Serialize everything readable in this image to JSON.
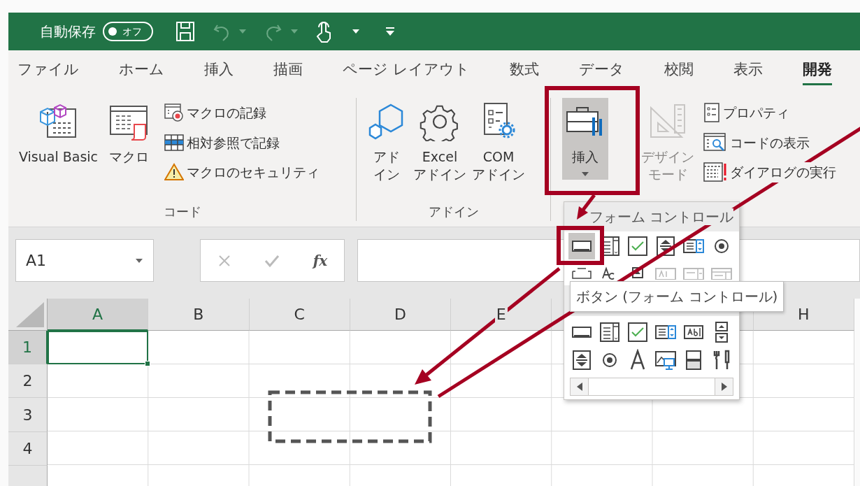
{
  "title_bar": {
    "autosave_label": "自動保存",
    "autosave_toggle": {
      "label": "オフ",
      "on": false
    },
    "tools": [
      {
        "disabled": false
      },
      {
        "disabled": true
      },
      {
        "disabled": true
      },
      {
        "disabled": false
      }
    ]
  },
  "ribbon_tabs": [
    {
      "label": "ファイル",
      "selected": false
    },
    {
      "label": "ホーム",
      "selected": false
    },
    {
      "label": "挿入",
      "selected": false
    },
    {
      "label": "描画",
      "selected": false
    },
    {
      "label": "ページ レイアウト",
      "selected": false
    },
    {
      "label": "数式",
      "selected": false
    },
    {
      "label": "データ",
      "selected": false
    },
    {
      "label": "校閲",
      "selected": false
    },
    {
      "label": "表示",
      "selected": false
    },
    {
      "label": "開発",
      "selected": true
    }
  ],
  "ribbon_groups": [
    {
      "label": "コード",
      "large_buttons": [
        {
          "lines": [
            "Visual Basic"
          ],
          "pressed": false,
          "disabled": false
        },
        {
          "lines": [
            "マクロ"
          ],
          "pressed": false,
          "disabled": false
        }
      ],
      "small_buttons": [
        {
          "label": "マクロの記録"
        },
        {
          "label": "相対参照で記録"
        },
        {
          "label": "マクロのセキュリティ"
        }
      ]
    },
    {
      "label": "アドイン",
      "large_buttons": [
        {
          "lines": [
            "アド",
            "イン"
          ],
          "pressed": false,
          "disabled": false
        },
        {
          "lines": [
            "Excel",
            "アドイン"
          ],
          "pressed": false,
          "disabled": false
        },
        {
          "lines": [
            "COM",
            "アドイン"
          ],
          "pressed": false,
          "disabled": false
        }
      ]
    },
    {
      "large_buttons": [
        {
          "lines": [
            "挿入"
          ],
          "pressed": true,
          "disabled": false,
          "dropdown": true
        },
        {
          "lines": [
            "デザイン",
            "モード"
          ],
          "pressed": false,
          "disabled": true
        }
      ],
      "small_buttons": [
        {
          "label": "プロパティ"
        },
        {
          "label": "コードの表示"
        },
        {
          "label": "ダイアログの実行"
        }
      ]
    }
  ],
  "formula_bar": {
    "name_box": "A1",
    "function_label": "fx"
  },
  "sheet": {
    "columns": [
      {
        "label": "A",
        "selected": true
      },
      {
        "label": "B",
        "selected": false
      },
      {
        "label": "C",
        "selected": false
      },
      {
        "label": "D",
        "selected": false
      },
      {
        "label": "E",
        "selected": false
      },
      {
        "selected": false
      },
      {
        "selected": false
      },
      {
        "label": "H",
        "selected": false
      }
    ],
    "rows": [
      {
        "label": "1",
        "selected": true
      },
      {
        "label": "2",
        "selected": false
      },
      {
        "label": "3",
        "selected": false
      },
      {
        "label": "4",
        "selected": false
      },
      {
        "selected": false
      }
    ]
  },
  "insert_menu": {
    "header": "フォーム コントロール",
    "form_controls": [
      {
        "selected": true
      },
      {
        "selected": false
      },
      {
        "selected": false
      },
      {
        "selected": false
      },
      {
        "selected": false
      },
      {
        "selected": false
      },
      {
        "selected": false
      },
      {
        "selected": false
      },
      {
        "selected": false
      },
      {
        "selected": false
      },
      {
        "selected": false
      },
      {
        "selected": false
      }
    ],
    "activex_controls": [
      {
        "selected": false
      },
      {
        "selected": false
      },
      {
        "selected": false
      },
      {
        "selected": false
      },
      {
        "selected": false
      },
      {
        "selected": false
      },
      {
        "selected": false
      },
      {
        "selected": false
      },
      {
        "selected": false
      },
      {
        "selected": false
      },
      {
        "selected": false
      },
      {
        "selected": false
      }
    ],
    "tooltip": "ボタン (フォーム コントロール)"
  }
}
